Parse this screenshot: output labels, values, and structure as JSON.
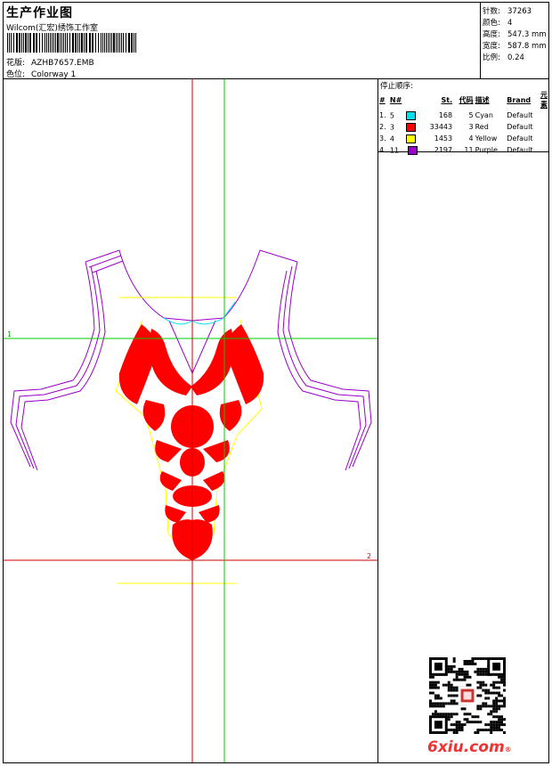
{
  "header": {
    "title": "生产作业图",
    "subtitle": "Wilcom(汇宏)绣饰工作室",
    "design_label": "花版:",
    "design_value": "AZHB7657.EMB",
    "colorway_label": "色位:",
    "colorway_value": "Colorway 1"
  },
  "stats": [
    {
      "label": "针数:",
      "value": "37263"
    },
    {
      "label": "颜色:",
      "value": "4"
    },
    {
      "label": "高度:",
      "value": "547.3 mm"
    },
    {
      "label": "宽度:",
      "value": "587.8 mm"
    },
    {
      "label": "比例:",
      "value": "0.24"
    }
  ],
  "stop_sequence": {
    "title": "停止顺序:",
    "columns": [
      "#",
      "N#",
      "St.",
      "代码",
      "描述",
      "Brand",
      "元素"
    ],
    "rows": [
      {
        "idx": "1.",
        "n": "5",
        "color": "#00e0f0",
        "stitches": "168",
        "code": "5",
        "desc": "Cyan",
        "brand": "Default"
      },
      {
        "idx": "2.",
        "n": "3",
        "color": "#ff0000",
        "stitches": "33443",
        "code": "3",
        "desc": "Red",
        "brand": "Default"
      },
      {
        "idx": "3.",
        "n": "4",
        "color": "#ffff00",
        "stitches": "1453",
        "code": "4",
        "desc": "Yellow",
        "brand": "Default"
      },
      {
        "idx": "4.",
        "n": "11",
        "color": "#9900cc",
        "stitches": "2197",
        "code": "11",
        "desc": "Purple",
        "brand": "Default"
      }
    ]
  },
  "guides": {
    "h1": "1",
    "h2": "2"
  },
  "watermark": {
    "text": "6xiu.com",
    "mark": "®"
  }
}
